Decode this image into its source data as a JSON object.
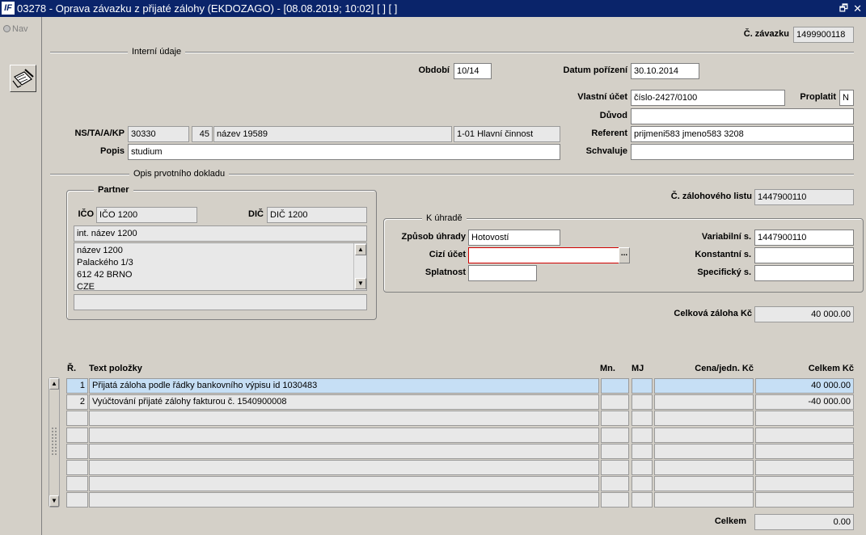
{
  "window": {
    "title": "03278 - Oprava závazku z přijaté zálohy (EKDOZAGO) - [08.08.2019; 10:02]  [ ]  [ ]",
    "logo_text": "IF",
    "restore_icon": "restore-icon",
    "close_icon": "close-icon"
  },
  "nav": {
    "label": "Nav"
  },
  "toolbar": {
    "icon": "edit-document-icon"
  },
  "header": {
    "zavazek_label": "Č. závazku",
    "zavazek_value": "1499900118"
  },
  "interni": {
    "section_label": "Interní údaje",
    "obdobi_label": "Období",
    "obdobi_value": "10/14",
    "datum_label": "Datum pořízení",
    "datum_value": "30.10.2014",
    "ucet_label": "Vlastní účet",
    "ucet_value": "číslo-2427/0100",
    "proplatit_label": "Proplatit",
    "proplatit_value": "N",
    "duvod_label": "Důvod",
    "duvod_value": "",
    "ns_label": "NS/TA/A/KP",
    "ns1": "30330",
    "ns2": "45",
    "ns3": "název 19589",
    "ns4": "1-01 Hlavní činnost",
    "referent_label": "Referent",
    "referent_value": "prijmeni583 jmeno583 3208",
    "popis_label": "Popis",
    "popis_value": "studium",
    "schvaluje_label": "Schvaluje",
    "schvaluje_value": ""
  },
  "opis": {
    "section_label": "Opis prvotního dokladu",
    "partner_label": "Partner",
    "ico_label": "IČO",
    "ico_value": "IČO 1200",
    "dic_label": "DIČ",
    "dic_value": "DIČ 1200",
    "int_nazev": "int. název 1200",
    "address": [
      "název 1200",
      "Palackého 1/3",
      "612 42 BRNO",
      "CZE"
    ],
    "extra": "",
    "zal_listu_label": "Č. zálohového listu",
    "zal_listu_value": "1447900110"
  },
  "uhrada": {
    "group_label": "K úhradě",
    "zpusob_label": "Způsob úhrady",
    "zpusob_value": "Hotovostí",
    "cizi_label": "Cizí účet",
    "cizi_value": "",
    "splatnost_label": "Splatnost",
    "splatnost_value": "",
    "var_label": "Variabilní s.",
    "var_value": "1447900110",
    "konst_label": "Konstantní s.",
    "konst_value": "",
    "spec_label": "Specifický s.",
    "spec_value": "",
    "ellipsis": "..."
  },
  "celkova": {
    "label": "Celková záloha Kč",
    "value": "40 000.00"
  },
  "grid": {
    "headers": {
      "r": "Ř.",
      "text": "Text položky",
      "mn": "Mn.",
      "mj": "MJ",
      "cena": "Cena/jedn. Kč",
      "celkem": "Celkem Kč"
    },
    "rows": [
      {
        "r": "1",
        "text": "Přijatá záloha podle řádky bankovního výpisu id 1030483",
        "mn": "",
        "mj": "",
        "cena": "",
        "celkem": "40 000.00"
      },
      {
        "r": "2",
        "text": "Vyúčtování přijaté zálohy fakturou č. 1540900008",
        "mn": "",
        "mj": "",
        "cena": "",
        "celkem": "-40 000.00"
      },
      {
        "r": "",
        "text": "",
        "mn": "",
        "mj": "",
        "cena": "",
        "celkem": ""
      },
      {
        "r": "",
        "text": "",
        "mn": "",
        "mj": "",
        "cena": "",
        "celkem": ""
      },
      {
        "r": "",
        "text": "",
        "mn": "",
        "mj": "",
        "cena": "",
        "celkem": ""
      },
      {
        "r": "",
        "text": "",
        "mn": "",
        "mj": "",
        "cena": "",
        "celkem": ""
      },
      {
        "r": "",
        "text": "",
        "mn": "",
        "mj": "",
        "cena": "",
        "celkem": ""
      },
      {
        "r": "",
        "text": "",
        "mn": "",
        "mj": "",
        "cena": "",
        "celkem": ""
      }
    ]
  },
  "footer": {
    "celkem_label": "Celkem",
    "celkem_value": "0.00"
  }
}
